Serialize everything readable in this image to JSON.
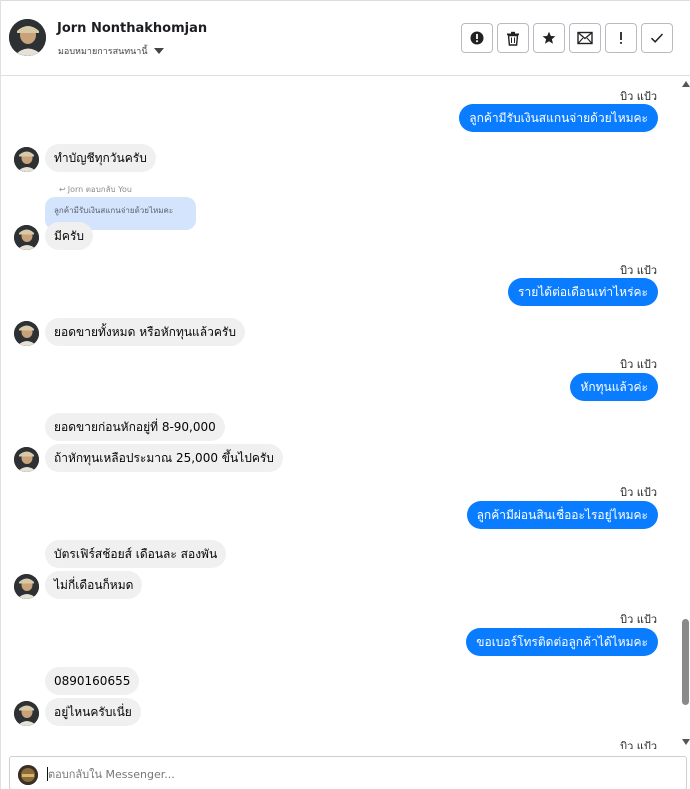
{
  "header": {
    "contact_name": "Jorn Nonthakhomjan",
    "assign_label": "มอบหมายการสนทนานี้",
    "actions": [
      {
        "name": "spam-button",
        "icon": "alert-circle-icon"
      },
      {
        "name": "delete-button",
        "icon": "trash-icon"
      },
      {
        "name": "star-button",
        "icon": "star-icon"
      },
      {
        "name": "mark-unread-button",
        "icon": "envelope-icon"
      },
      {
        "name": "important-button",
        "icon": "exclamation-icon"
      },
      {
        "name": "done-button",
        "icon": "check-icon"
      }
    ]
  },
  "thread": {
    "sender_name": "บิว แป้ว",
    "messages": [
      {
        "dir": "out",
        "text": "ลูกค้ามีรับเงินสแกนจ่ายด้วยไหมคะ"
      },
      {
        "dir": "in",
        "text": "ทำบัญชีทุกวันครับ"
      },
      {
        "dir": "reply",
        "label": "Jorn ตอบกลับ You",
        "quote": "ลูกค้ามีรับเงินสแกนจ่ายด้วยไหมคะ"
      },
      {
        "dir": "in",
        "text": "มีครับ"
      },
      {
        "dir": "out",
        "text": "รายได้ต่อเดือนเท่าไหร่คะ"
      },
      {
        "dir": "in",
        "text": "ยอดขายทั้งหมด หรือหักทุนแล้วครับ"
      },
      {
        "dir": "out",
        "text": "หักทุนแล้วค่ะ"
      },
      {
        "dir": "in",
        "text": "ยอดขายก่อนหักอยู่ที่ 8-90,000"
      },
      {
        "dir": "in",
        "text": "ถ้าหักทุนเหลือประมาณ 25,000 ขึ้นไปครับ"
      },
      {
        "dir": "out",
        "text": "ลูกค้ามีผ่อนสินเชื่ออะไรอยู่ไหมคะ"
      },
      {
        "dir": "in",
        "text": "บัตรเฟิร์สช้อยส์ เดือนละ สองพัน"
      },
      {
        "dir": "in",
        "text": "ไม่กี่เดือนก็หมด"
      },
      {
        "dir": "out",
        "text": "ขอเบอร์โทรติดต่อลูกค้าได้ไหมคะ"
      },
      {
        "dir": "in",
        "text": "0890160655"
      },
      {
        "dir": "in",
        "text": "อยู่ไหนครับเนี่ย"
      }
    ]
  },
  "composer": {
    "placeholder": "ตอบกลับใน Messenger..."
  },
  "colors": {
    "outgoing_bubble": "#0a7cff",
    "incoming_bubble": "#f0f0f0",
    "reply_quote": "#d4e4fc"
  }
}
